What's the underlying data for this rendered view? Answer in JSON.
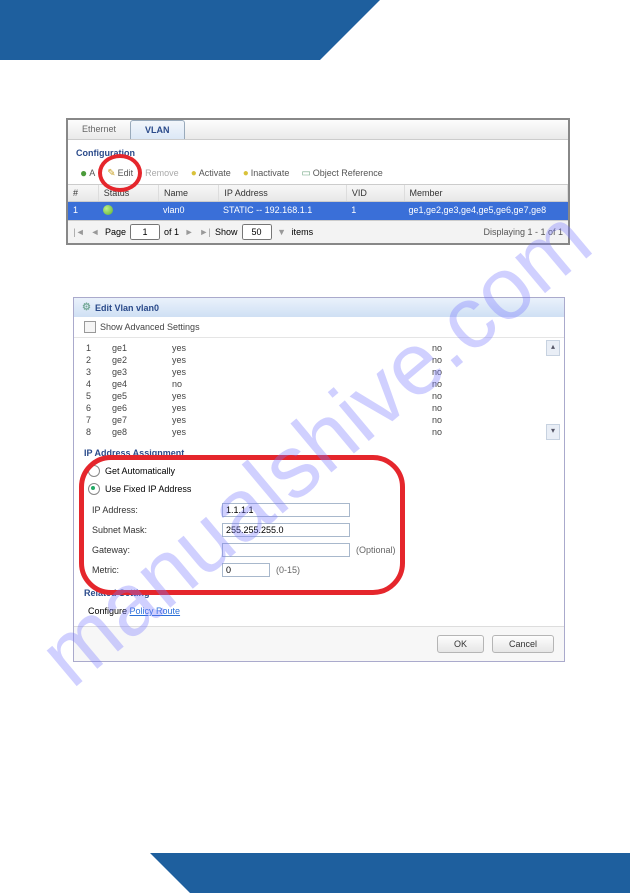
{
  "watermark": "manualshive.com",
  "panel1": {
    "tabs": {
      "ethernet": "Ethernet",
      "vlan": "VLAN"
    },
    "config_label": "Configuration",
    "toolbar": {
      "add": "A",
      "edit": "Edit",
      "remove": "Remove",
      "activate": "Activate",
      "inactivate": "Inactivate",
      "obj_ref": "Object Reference"
    },
    "head": {
      "num": "#",
      "status": "Status",
      "name": "Name",
      "ip": "IP Address",
      "vid": "VID",
      "member": "Member"
    },
    "row": {
      "num": "1",
      "name": "vlan0",
      "ip": "STATIC -- 192.168.1.1",
      "vid": "1",
      "member": "ge1,ge2,ge3,ge4,ge5,ge6,ge7,ge8"
    },
    "paging": {
      "page_label": "Page",
      "page_val": "1",
      "of": "of 1",
      "show": "Show",
      "per": "50",
      "items": "items",
      "disp": "Displaying 1 - 1 of 1"
    }
  },
  "panel2": {
    "title": "Edit Vlan vlan0",
    "adv": "Show Advanced Settings",
    "ports": [
      {
        "n": "1",
        "name": "ge1",
        "a": "yes",
        "b": "no"
      },
      {
        "n": "2",
        "name": "ge2",
        "a": "yes",
        "b": "no"
      },
      {
        "n": "3",
        "name": "ge3",
        "a": "yes",
        "b": "no"
      },
      {
        "n": "4",
        "name": "ge4",
        "a": "no",
        "b": "no"
      },
      {
        "n": "5",
        "name": "ge5",
        "a": "yes",
        "b": "no"
      },
      {
        "n": "6",
        "name": "ge6",
        "a": "yes",
        "b": "no"
      },
      {
        "n": "7",
        "name": "ge7",
        "a": "yes",
        "b": "no"
      },
      {
        "n": "8",
        "name": "ge8",
        "a": "yes",
        "b": "no"
      }
    ],
    "ipassign": {
      "header": "IP Address Assignment",
      "auto": "Get Automatically",
      "fixed": "Use Fixed IP Address",
      "ip_label": "IP Address:",
      "ip_val": "1.1.1.1",
      "mask_label": "Subnet Mask:",
      "mask_val": "255.255.255.0",
      "gw_label": "Gateway:",
      "gw_val": "",
      "optional": "(Optional)",
      "metric_label": "Metric:",
      "metric_val": "0",
      "metric_hint": "(0-15)"
    },
    "related": {
      "header": "Related Setting",
      "prefix": "Configure ",
      "link": "Policy Route"
    },
    "buttons": {
      "ok": "OK",
      "cancel": "Cancel"
    }
  }
}
